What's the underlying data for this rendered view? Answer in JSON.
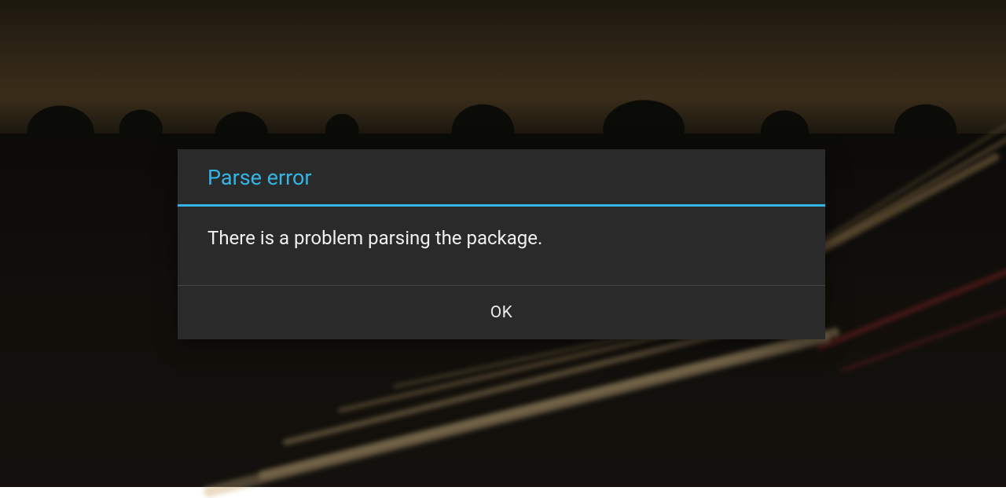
{
  "dialog": {
    "title": "Parse error",
    "message": "There is a problem parsing the package.",
    "ok_label": "OK",
    "accent_color": "#33b5e5"
  }
}
